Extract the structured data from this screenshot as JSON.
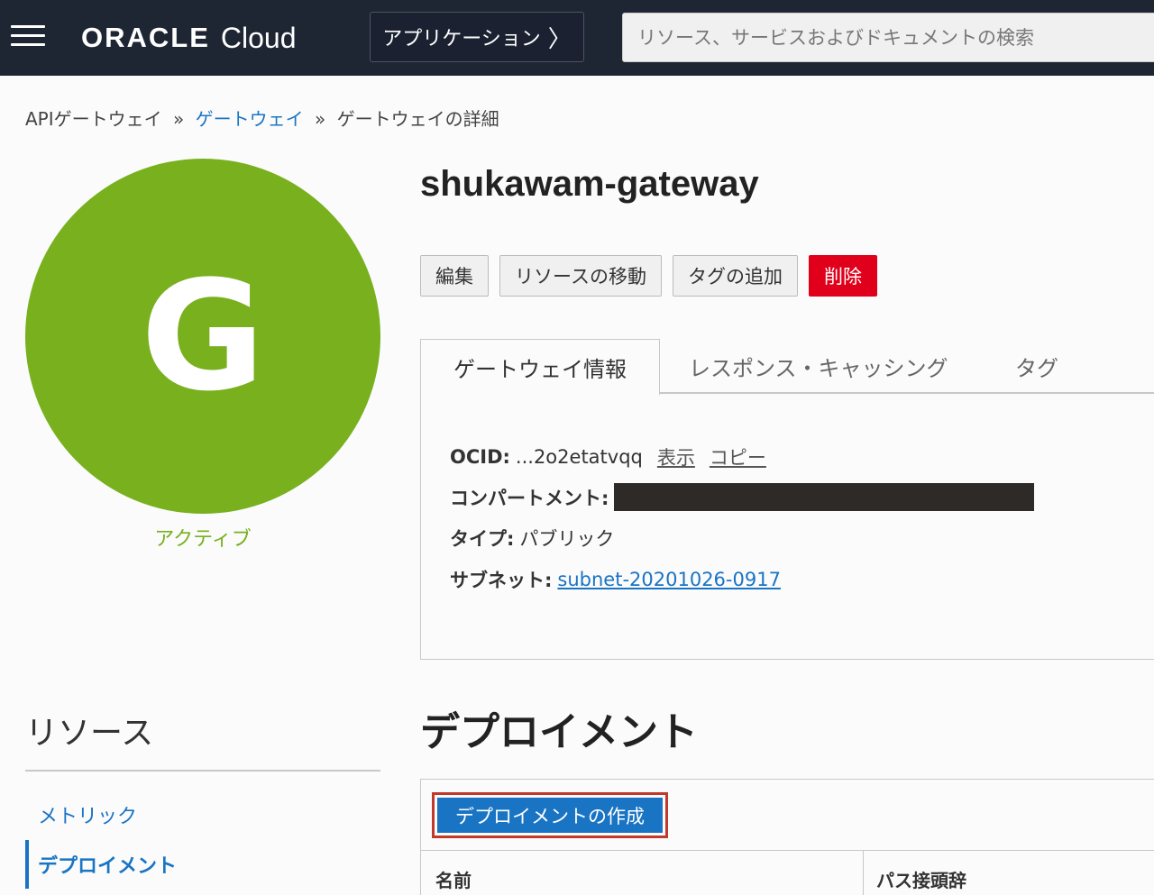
{
  "header": {
    "logo_oracle": "ORACLE",
    "logo_cloud": "Cloud",
    "apps_label": "アプリケーション",
    "apps_chevron": "〉",
    "search_placeholder": "リソース、サービスおよびドキュメントの検索"
  },
  "breadcrumb": {
    "item1": "APIゲートウェイ",
    "item2": "ゲートウェイ",
    "item3": "ゲートウェイの詳細",
    "separator": "»"
  },
  "avatar": {
    "letter": "G",
    "status": "アクティブ",
    "color": "#78b01e"
  },
  "title": "shukawam-gateway",
  "actions": {
    "edit": "編集",
    "move": "リソースの移動",
    "add_tag": "タグの追加",
    "delete": "削除"
  },
  "tabs": {
    "info": "ゲートウェイ情報",
    "caching": "レスポンス・キャッシング",
    "tags": "タグ"
  },
  "info": {
    "ocid_label": "OCID:",
    "ocid_value": "...2o2etatvqq",
    "show": "表示",
    "copy": "コピー",
    "compartment_label": "コンパートメント:",
    "type_label": "タイプ:",
    "type_value": "パブリック",
    "subnet_label": "サブネット:",
    "subnet_value": "subnet-20201026-0917"
  },
  "deployments": {
    "title": "デプロイメント",
    "create_button": "デプロイメントの作成",
    "columns": [
      "名前",
      "パス接頭辞"
    ]
  },
  "resources": {
    "title": "リソース",
    "items": [
      "メトリック",
      "デプロイメント"
    ]
  },
  "colors": {
    "accent": "#1a74c4",
    "danger": "#e0001b",
    "header_bg": "#1f2633",
    "highlight_border": "#c0392b"
  }
}
